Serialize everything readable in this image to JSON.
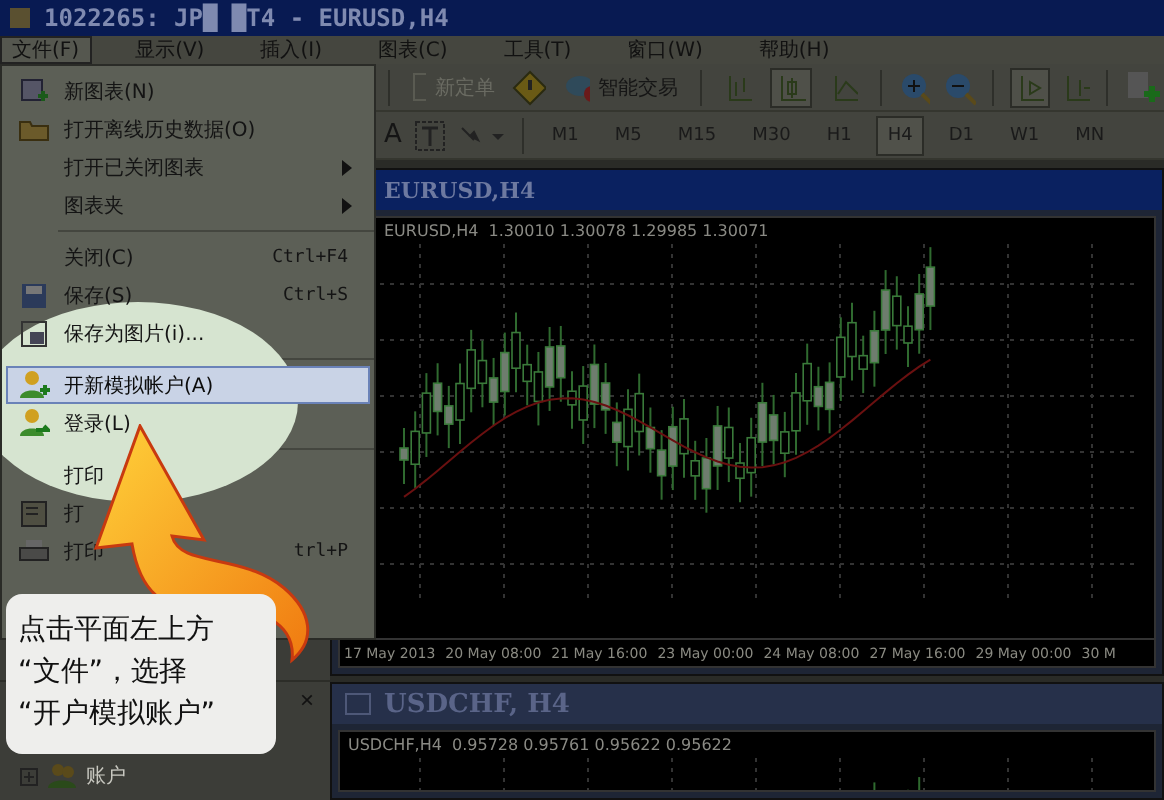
{
  "window": {
    "title": "1022265: JP█ █T4 - EURUSD,H4"
  },
  "menubar": [
    {
      "label": "文件(F)",
      "selected": true
    },
    {
      "label": "显示(V)",
      "selected": false
    },
    {
      "label": "插入(I)",
      "selected": false
    },
    {
      "label": "图表(C)",
      "selected": false
    },
    {
      "label": "工具(T)",
      "selected": false
    },
    {
      "label": "窗口(W)",
      "selected": false
    },
    {
      "label": "帮助(H)",
      "selected": false
    }
  ],
  "file_menu": {
    "items": [
      {
        "kind": "item",
        "label": "新图表(N)",
        "selected": false
      },
      {
        "kind": "item",
        "label": "打开离线历史数据(O)",
        "selected": false
      },
      {
        "kind": "submenu",
        "label": "打开已关闭图表",
        "selected": false
      },
      {
        "kind": "submenu",
        "label": "图表夹",
        "selected": false
      },
      {
        "kind": "separator"
      },
      {
        "kind": "item",
        "label": "关闭(C)",
        "shortcut": "Ctrl+F4",
        "selected": false
      },
      {
        "kind": "item",
        "label": "保存(S)",
        "shortcut": "Ctrl+S",
        "selected": false
      },
      {
        "kind": "item",
        "label": "保存为图片(i)...",
        "selected": false
      },
      {
        "kind": "separator"
      },
      {
        "kind": "item",
        "label": "开新模拟帐户(A)",
        "selected": true
      },
      {
        "kind": "item",
        "label": "登录(L)",
        "selected": false
      },
      {
        "kind": "separator"
      },
      {
        "kind": "item",
        "label": "打印",
        "selected": false
      },
      {
        "kind": "item",
        "label": "打",
        "selected": false
      },
      {
        "kind": "item",
        "label": "打印",
        "shortcut": "trl+P",
        "selected": false
      }
    ]
  },
  "toolbar": {
    "new_order": {
      "label": "新定单",
      "disabled": true
    },
    "expert": {
      "label": "智能交易"
    },
    "chart_types": [
      {
        "selected": false
      },
      {
        "selected": true
      },
      {
        "selected": false
      }
    ],
    "text_tool": "A",
    "timeframes": [
      {
        "label": "M1",
        "selected": false
      },
      {
        "label": "M5",
        "selected": false
      },
      {
        "label": "M15",
        "selected": false
      },
      {
        "label": "M30",
        "selected": false
      },
      {
        "label": "H1",
        "selected": false
      },
      {
        "label": "H4",
        "selected": true
      },
      {
        "label": "D1",
        "selected": false
      },
      {
        "label": "W1",
        "selected": false
      },
      {
        "label": "MN",
        "selected": false
      }
    ]
  },
  "navigator": {
    "close": "×",
    "items": [
      {
        "label": "账户"
      }
    ]
  },
  "charts": [
    {
      "title": "EURUSD,H4",
      "info": "EURUSD,H4  1.30010 1.30078 1.29985 1.30071",
      "dates": [
        "17 May 2013",
        "20 May 08:00",
        "21 May 16:00",
        "23 May 00:00",
        "24 May 08:00",
        "27 May 16:00",
        "29 May 00:00",
        "30 M"
      ]
    },
    {
      "title": "USDCHF, H4",
      "info": "USDCHF,H4  0.95728 0.95761 0.95622 0.95622"
    }
  ],
  "callout": {
    "lines": [
      "点击平面左上方",
      "“文件”，选择",
      "“开户模拟账户”"
    ]
  }
}
